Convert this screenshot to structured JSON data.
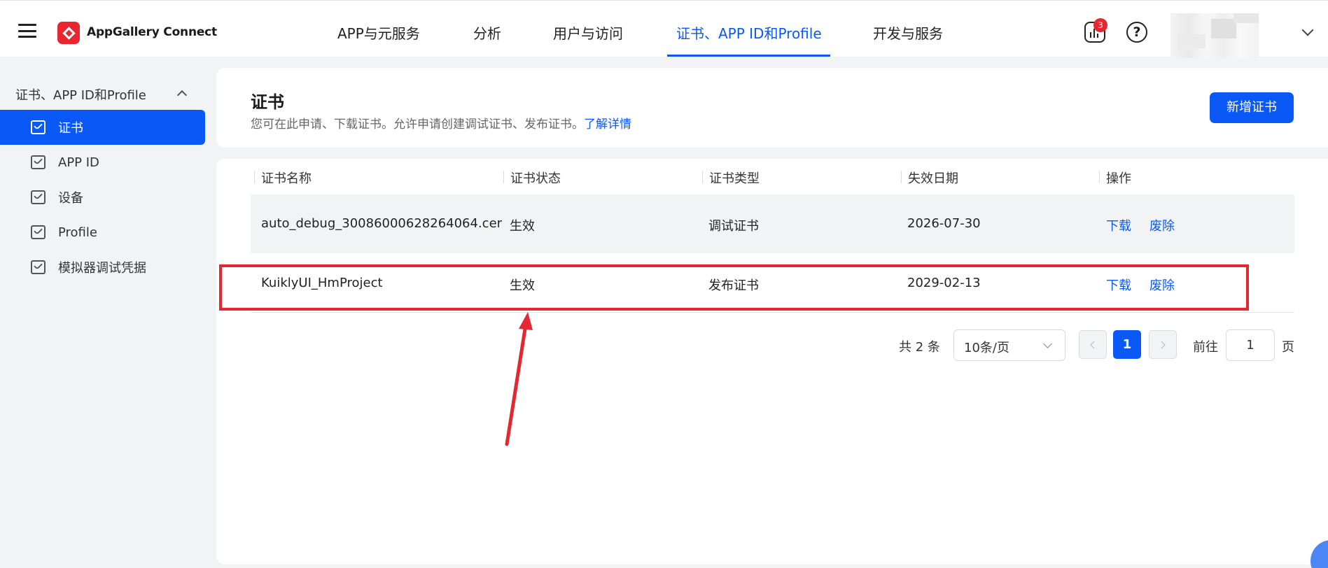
{
  "header": {
    "brand": "AppGallery Connect",
    "nav": [
      "APP与元服务",
      "分析",
      "用户与访问",
      "证书、APP ID和Profile",
      "开发与服务"
    ],
    "active_nav_index": 3,
    "notification_count": "3",
    "help_glyph": "?"
  },
  "sidebar": {
    "group_label": "证书、APP ID和Profile",
    "items": [
      {
        "label": "证书",
        "active": true
      },
      {
        "label": "APP ID",
        "active": false
      },
      {
        "label": "设备",
        "active": false
      },
      {
        "label": "Profile",
        "active": false
      },
      {
        "label": "模拟器调试凭据",
        "active": false
      }
    ]
  },
  "page": {
    "title": "证书",
    "description": "您可在此申请、下载证书。允许申请创建调试证书、发布证书。",
    "learn_more": "了解详情",
    "add_button": "新增证书"
  },
  "table": {
    "headers": [
      "证书名称",
      "证书状态",
      "证书类型",
      "失效日期",
      "操作"
    ],
    "rows": [
      {
        "name": "auto_debug_30086000628264064.cer",
        "status": "生效",
        "type": "调试证书",
        "expiry": "2026-07-30",
        "actions": [
          "下载",
          "废除"
        ]
      },
      {
        "name": "KuiklyUI_HmProject",
        "status": "生效",
        "type": "发布证书",
        "expiry": "2029-02-13",
        "actions": [
          "下载",
          "废除"
        ]
      }
    ]
  },
  "pagination": {
    "total": "共 2 条",
    "page_size": "10条/页",
    "current_page": "1",
    "goto_label": "前往",
    "goto_value": "1",
    "page_unit": "页"
  },
  "colors": {
    "accent": "#0a59f7",
    "brand_red": "#e8262f",
    "annotation_red": "#e32832"
  }
}
